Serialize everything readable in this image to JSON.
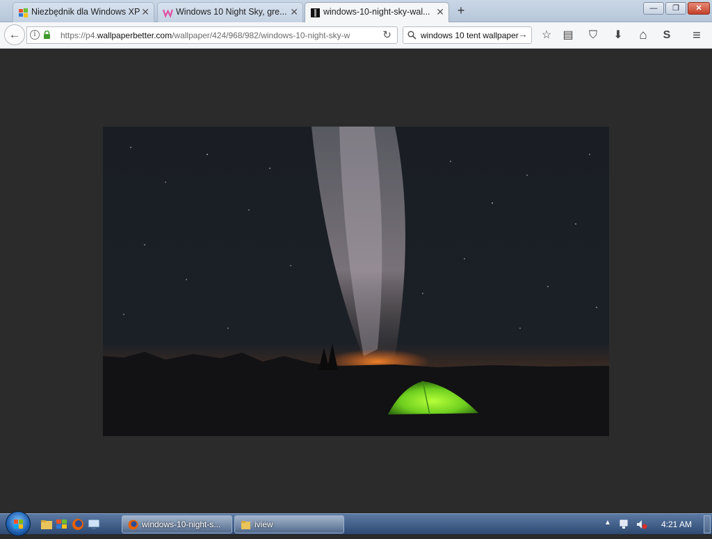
{
  "browser": {
    "tabs": [
      {
        "title": "Niezbędnik dla Windows XP",
        "favicon": "windows-xp-icon",
        "close": "✕"
      },
      {
        "title": "Windows 10 Night Sky, gre...",
        "favicon": "wallpaper-w-icon",
        "close": "✕"
      },
      {
        "title": "windows-10-night-sky-wal...",
        "favicon": "night-sky-thumb-icon",
        "close": "✕"
      }
    ],
    "new_tab": "+",
    "window_controls": {
      "minimize": "—",
      "maximize": "❐",
      "close": "✕"
    },
    "nav": {
      "back": "←",
      "url_prefix": "https://p4.",
      "url_domain": "wallpaperbetter.com",
      "url_path": "/wallpaper/424/968/982/windows-10-night-sky-w",
      "reload": "↻",
      "search_value": "windows 10 tent wallpaper",
      "search_go": "→"
    },
    "toolbar": {
      "bookmark": "☆",
      "reader": "▤",
      "pocket": "⛉",
      "download": "⬇",
      "home": "⌂",
      "sync": "S",
      "menu": "≡"
    }
  },
  "taskbar": {
    "buttons": [
      {
        "label": "windows-10-night-s...",
        "icon": "firefox-icon"
      },
      {
        "label": "iview",
        "icon": "folder-icon"
      }
    ],
    "tray_arrow": "▲",
    "clock": "4:21 AM"
  }
}
